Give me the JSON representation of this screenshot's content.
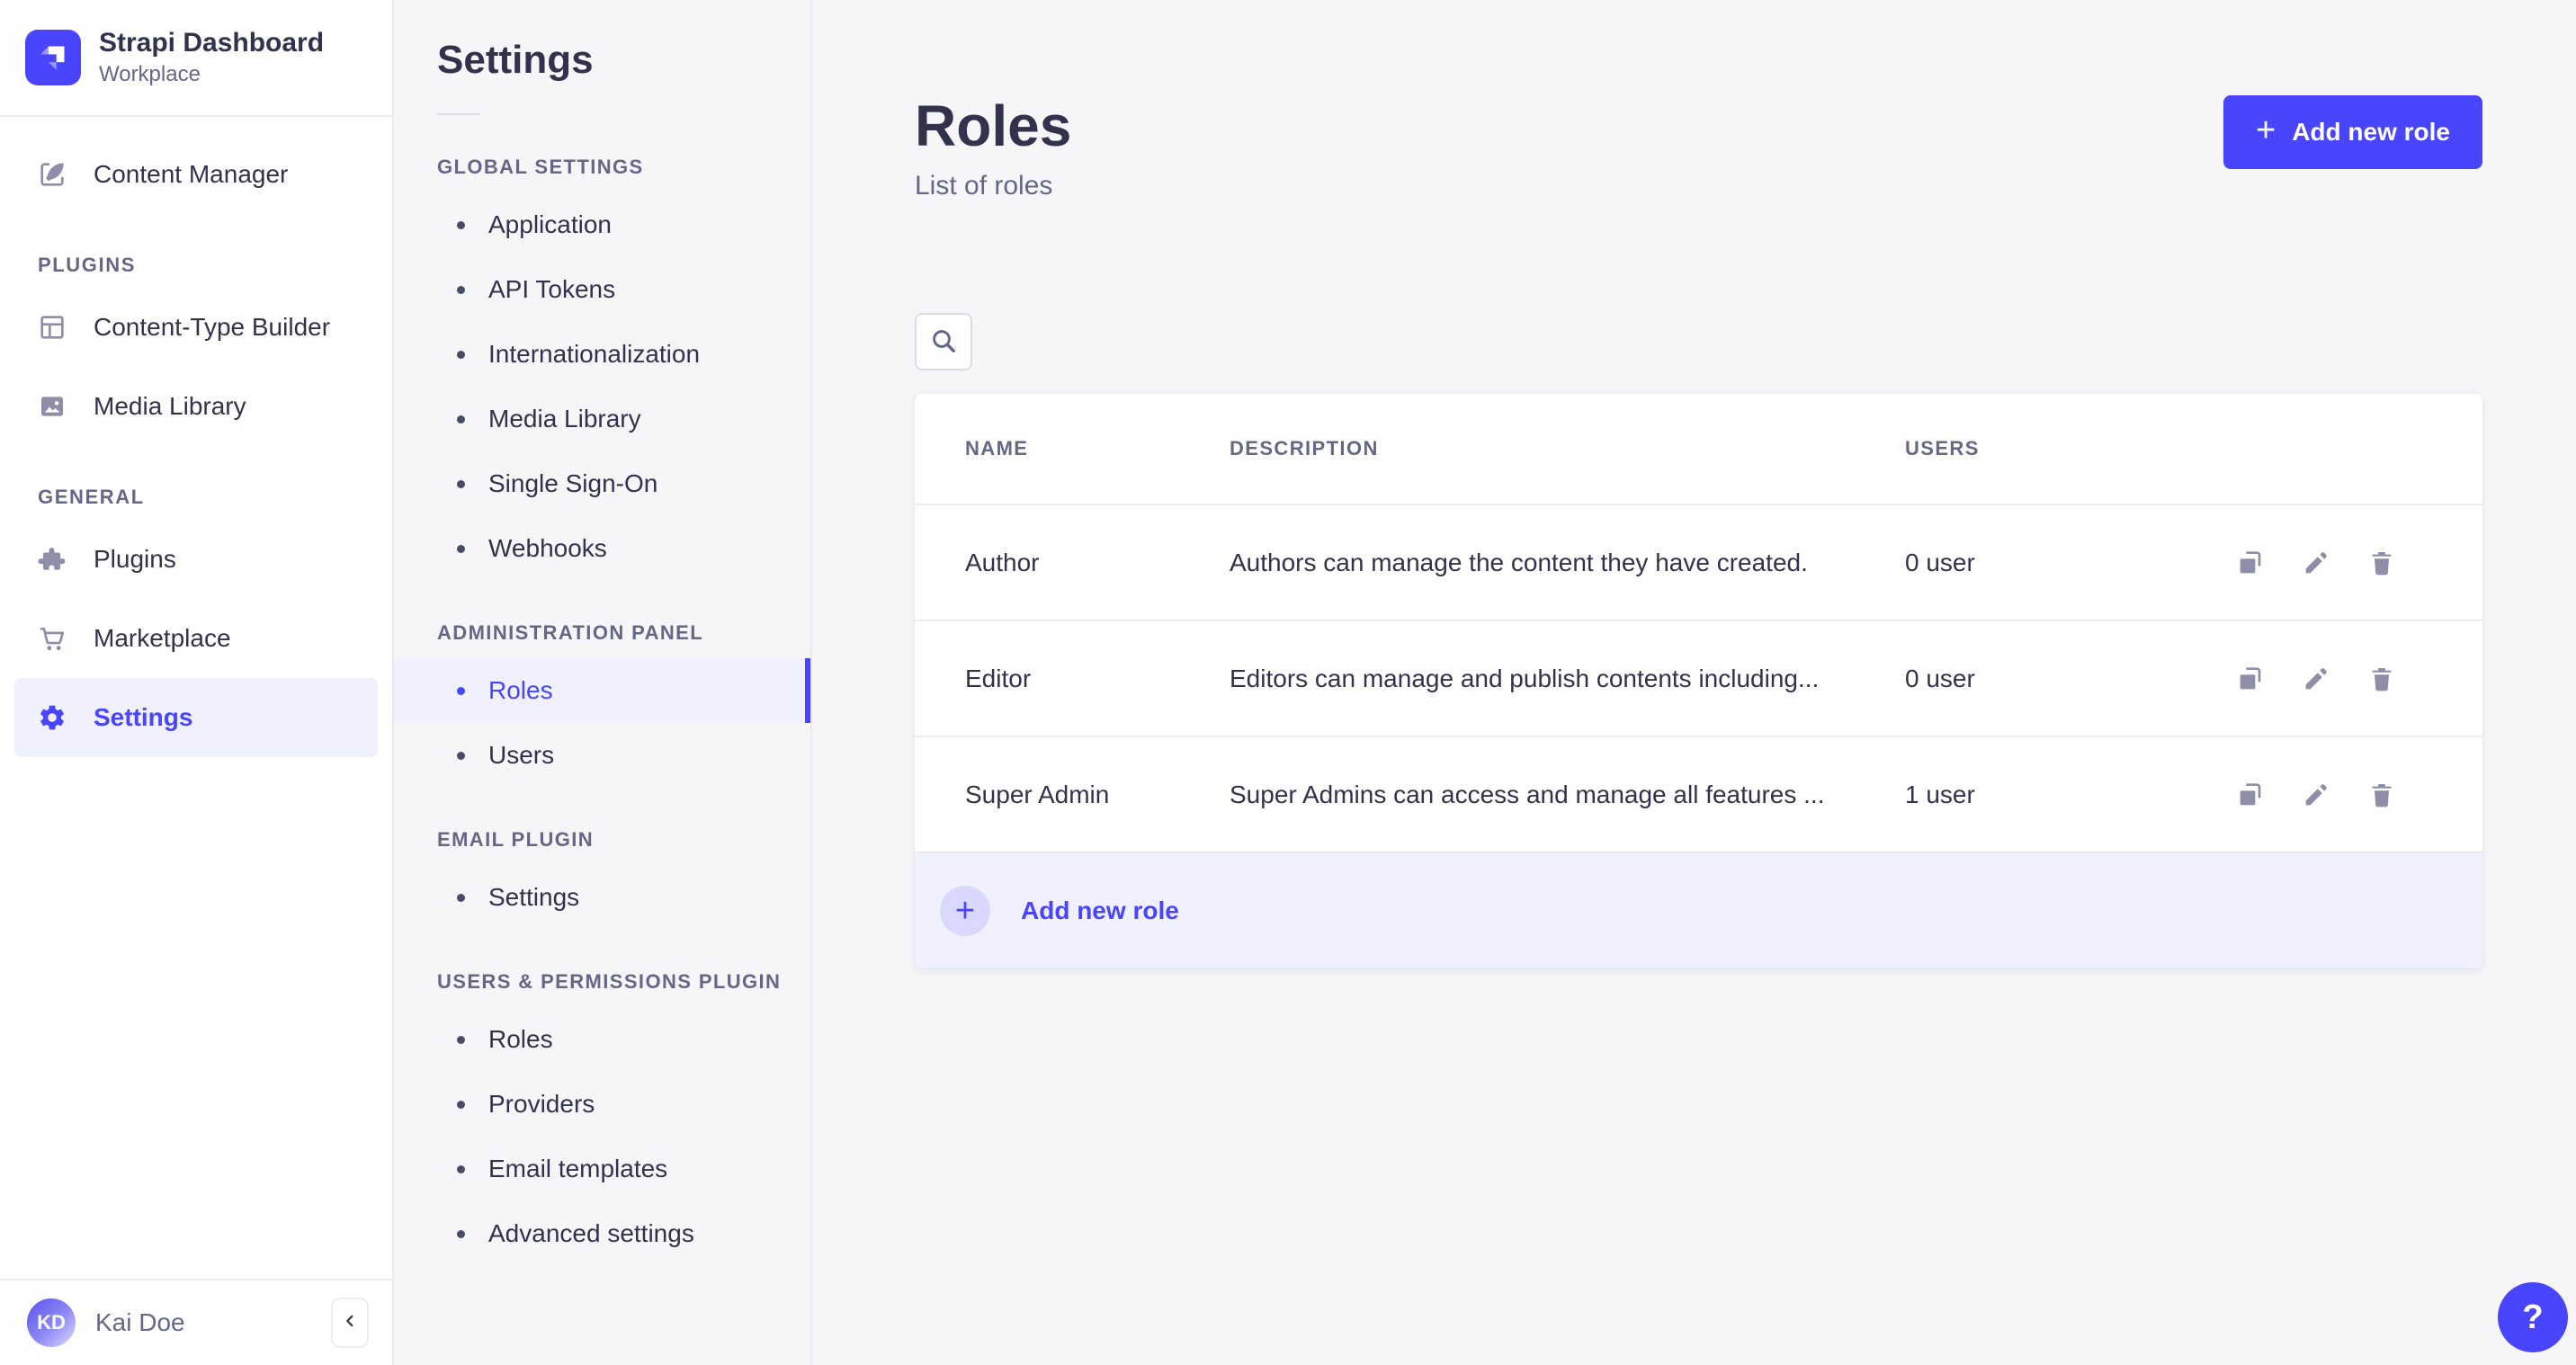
{
  "app": {
    "title": "Strapi Dashboard",
    "workspace": "Workplace"
  },
  "colors": {
    "primary": "#4945ff",
    "primary_light": "#f0f0ff",
    "primary_soft": "#d9d8ff",
    "text_dark": "#32324d",
    "text_muted": "#666687",
    "icon_muted": "#8e8ea9",
    "border": "#eaeaef",
    "input_border": "#dcdce4",
    "background": "#f6f6f9",
    "surface": "#ffffff"
  },
  "sidebar": {
    "content_manager_label": "Content Manager",
    "sections": [
      {
        "label": "PLUGINS",
        "items": [
          {
            "label": "Content-Type Builder",
            "icon": "content-type-builder-icon"
          },
          {
            "label": "Media Library",
            "icon": "media-library-icon"
          }
        ]
      },
      {
        "label": "GENERAL",
        "items": [
          {
            "label": "Plugins",
            "icon": "puzzle-icon"
          },
          {
            "label": "Marketplace",
            "icon": "cart-icon"
          },
          {
            "label": "Settings",
            "icon": "gear-icon",
            "active": true
          }
        ]
      }
    ],
    "user": {
      "initials": "KD",
      "name": "Kai Doe"
    }
  },
  "settings_nav": {
    "title": "Settings",
    "active_item": "Roles",
    "sections": [
      {
        "label": "GLOBAL SETTINGS",
        "items": [
          "Application",
          "API Tokens",
          "Internationalization",
          "Media Library",
          "Single Sign-On",
          "Webhooks"
        ]
      },
      {
        "label": "ADMINISTRATION PANEL",
        "items": [
          "Roles",
          "Users"
        ]
      },
      {
        "label": "EMAIL PLUGIN",
        "items": [
          "Settings"
        ]
      },
      {
        "label": "USERS & PERMISSIONS PLUGIN",
        "items": [
          "Roles",
          "Providers",
          "Email templates",
          "Advanced settings"
        ]
      }
    ]
  },
  "page": {
    "title": "Roles",
    "subtitle": "List of roles",
    "add_button_label": "Add new role",
    "table": {
      "columns": [
        "NAME",
        "DESCRIPTION",
        "USERS"
      ],
      "rows": [
        {
          "name": "Author",
          "description": "Authors can manage the content they have created.",
          "users": "0 user"
        },
        {
          "name": "Editor",
          "description": "Editors can manage and publish contents including...",
          "users": "0 user"
        },
        {
          "name": "Super Admin",
          "description": "Super Admins can access and manage all features ...",
          "users": "1 user"
        }
      ],
      "footer_label": "Add new role"
    }
  },
  "glyphs": {
    "plus": "+",
    "help": "?"
  }
}
